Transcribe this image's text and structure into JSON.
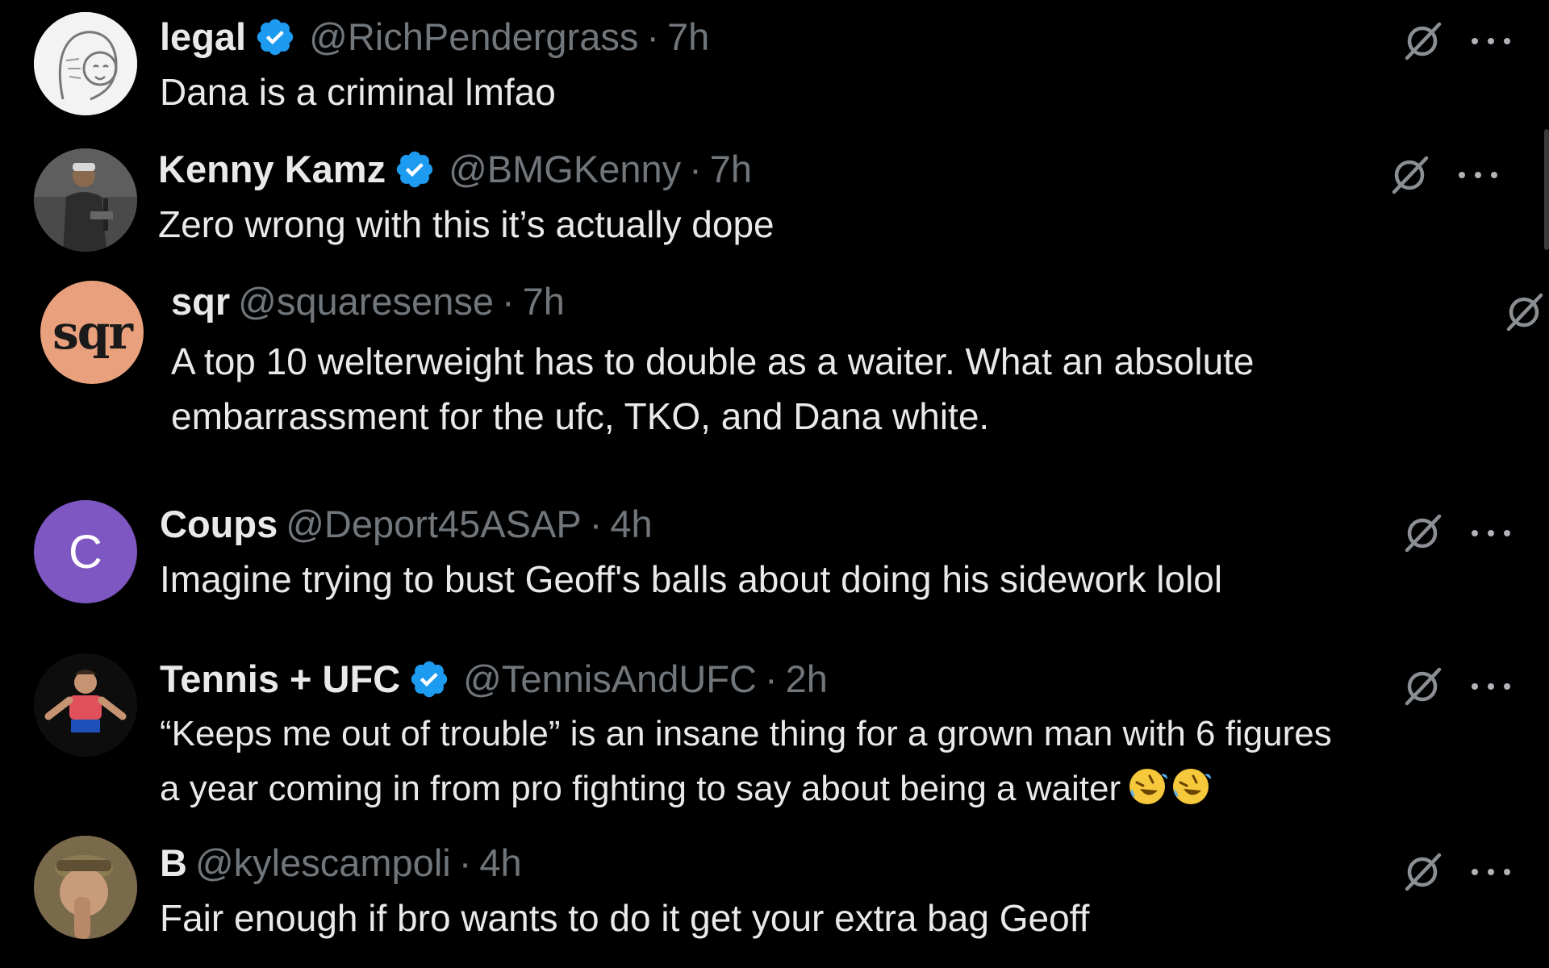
{
  "replies": [
    {
      "name": "legal",
      "verified": true,
      "handle": "@RichPendergrass",
      "separator": "·",
      "time": "7h",
      "text": "Dana is a criminal lmfao",
      "avatar_icon": "sketch-face-avatar"
    },
    {
      "name": "Kenny Kamz",
      "verified": true,
      "handle": "@BMGKenny",
      "separator": "·",
      "time": "7h",
      "text": "Zero wrong with this it’s actually dope",
      "avatar_icon": "person-photo-avatar"
    },
    {
      "name": "sqr",
      "verified": false,
      "handle": "@squaresense",
      "separator": "·",
      "time": "7h",
      "text_line1": "A top 10 welterweight has to double as a waiter. What an absolute",
      "text_line2": "embarrassment for the ufc, TKO, and Dana white.",
      "avatar_text": "sqr"
    },
    {
      "name": "Coups",
      "verified": false,
      "handle": "@Deport45ASAP",
      "separator": "·",
      "time": "4h",
      "text": "Imagine trying to bust Geoff's balls about doing his sidework lolol",
      "avatar_text": "C"
    },
    {
      "name": "Tennis + UFC",
      "verified": true,
      "handle": "@TennisAndUFC",
      "separator": "·",
      "time": "2h",
      "text_line1": "“Keeps me out of trouble” is an insane thing for a grown man with 6 figures",
      "text_line2": "a year coming in from pro fighting to say about being a waiter",
      "emoji": "rolling-on-floor-laughing-emoji",
      "avatar_icon": "boxer-photo-avatar"
    },
    {
      "name": "B",
      "verified": false,
      "handle": "@kylescampoli",
      "separator": "·",
      "time": "4h",
      "text": "Fair enough if bro wants to do it get your extra bag Geoff",
      "avatar_icon": "selfie-photo-avatar"
    }
  ],
  "icons": {
    "grok": "grok-icon",
    "more": "more-options-icon",
    "verified": "verified-badge-icon"
  },
  "colors": {
    "background": "#000000",
    "text_primary": "#e7e9ea",
    "text_secondary": "#71767b",
    "verified_blue": "#1d9bf0",
    "coups_avatar": "#7e57c2",
    "sqr_avatar": "#e9a07c"
  }
}
